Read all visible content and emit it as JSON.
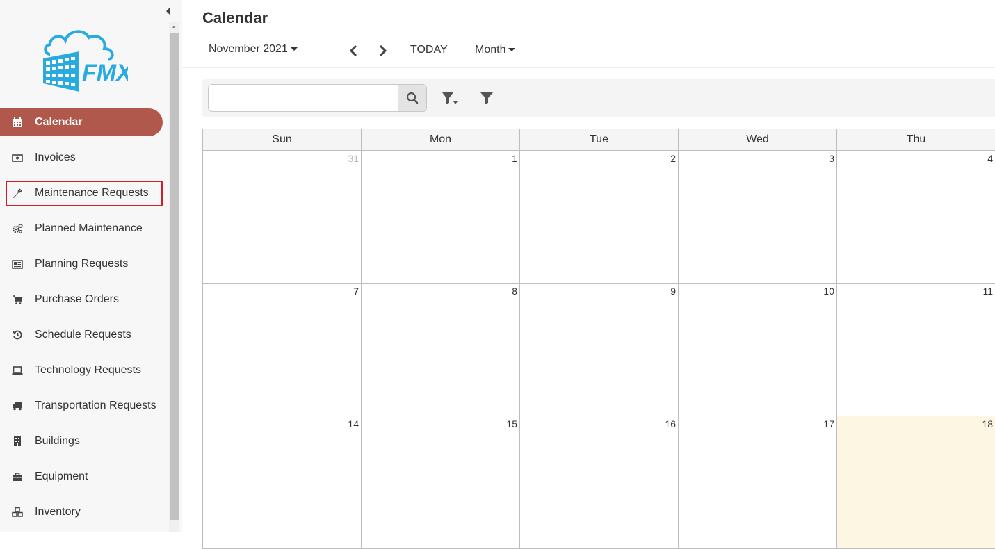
{
  "page": {
    "title": "Calendar"
  },
  "logo": {
    "text": "FMX",
    "color": "#29abe2"
  },
  "sidebar": {
    "items": [
      {
        "label": "Calendar",
        "icon": "calendar-icon",
        "active": true
      },
      {
        "label": "Invoices",
        "icon": "money-icon"
      },
      {
        "label": "Maintenance Requests",
        "icon": "wrench-icon",
        "highlighted": true
      },
      {
        "label": "Planned Maintenance",
        "icon": "gears-icon"
      },
      {
        "label": "Planning Requests",
        "icon": "newspaper-icon"
      },
      {
        "label": "Purchase Orders",
        "icon": "cart-icon"
      },
      {
        "label": "Schedule Requests",
        "icon": "history-icon"
      },
      {
        "label": "Technology Requests",
        "icon": "laptop-icon"
      },
      {
        "label": "Transportation Requests",
        "icon": "truck-icon"
      },
      {
        "label": "Buildings",
        "icon": "building-icon"
      },
      {
        "label": "Equipment",
        "icon": "toolbox-icon"
      },
      {
        "label": "Inventory",
        "icon": "boxes-icon"
      }
    ],
    "active_color": "#b0584b"
  },
  "toolbar": {
    "month_label": "November 2021",
    "today_label": "TODAY",
    "view_label": "Month"
  },
  "search": {
    "placeholder": "",
    "value": ""
  },
  "calendar": {
    "weekdays": [
      "Sun",
      "Mon",
      "Tue",
      "Wed",
      "Thu"
    ],
    "weeks": [
      [
        "31",
        "1",
        "2",
        "3",
        "4"
      ],
      [
        "7",
        "8",
        "9",
        "10",
        "11"
      ],
      [
        "14",
        "15",
        "16",
        "17",
        "18"
      ]
    ],
    "other_month_days": [
      "31"
    ],
    "today": "18",
    "today_color": "#fdf6e3"
  }
}
